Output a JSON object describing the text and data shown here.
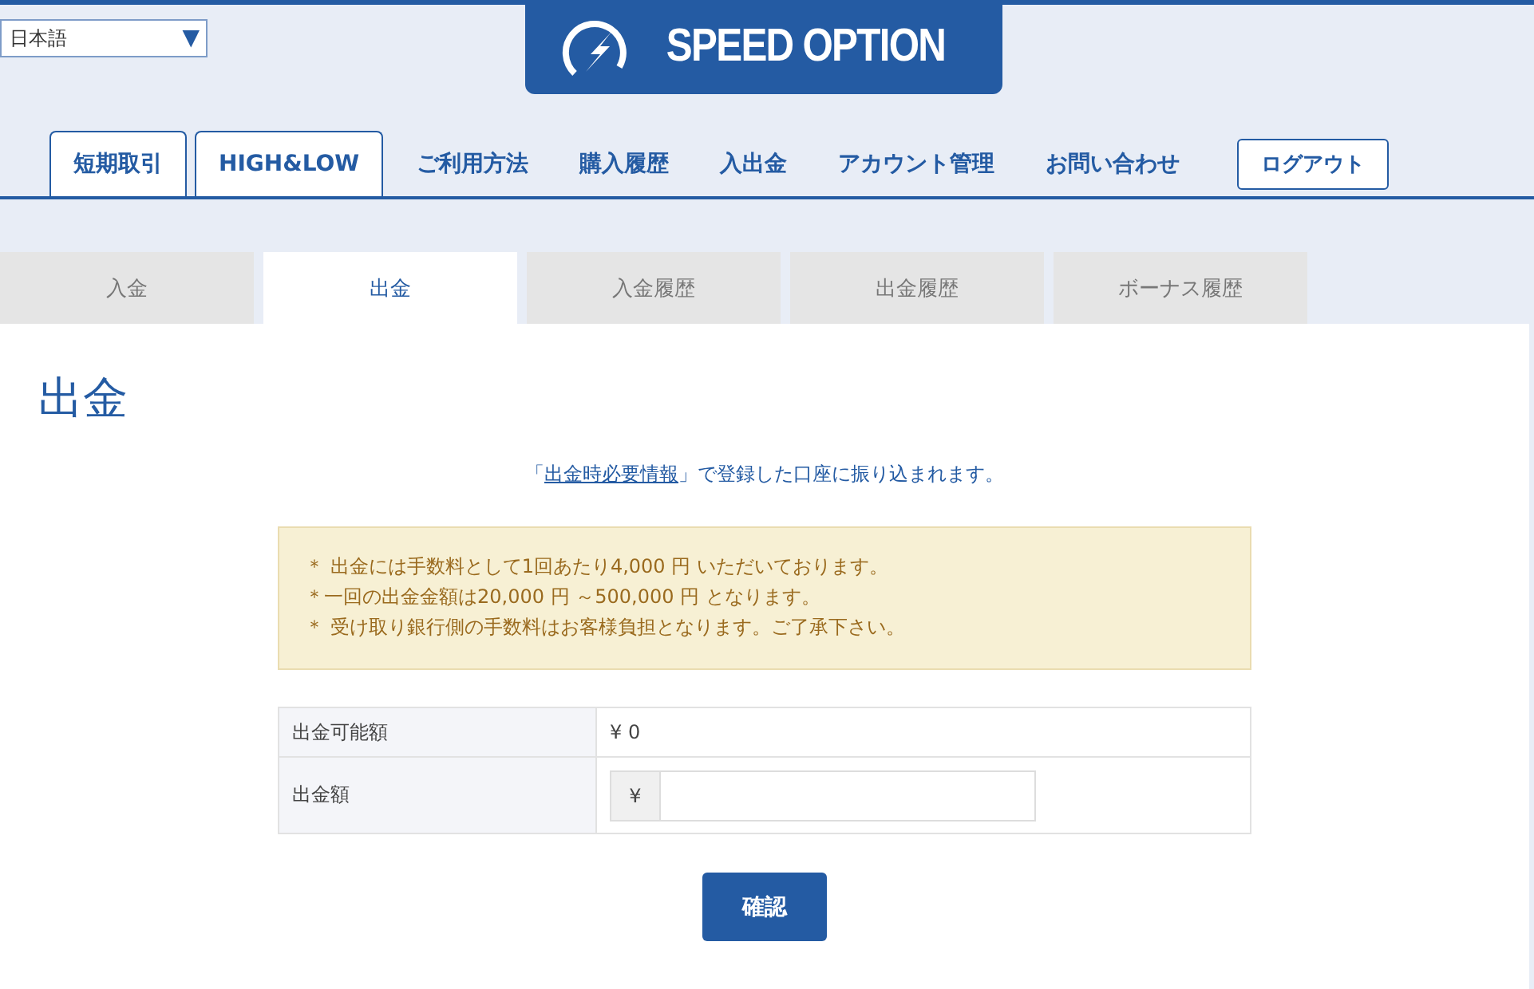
{
  "language_select": {
    "value": "日本語",
    "arrow": "▼"
  },
  "logo": {
    "text": "SPEED OPTION"
  },
  "nav": [
    {
      "label": "短期取引",
      "kind": "tab"
    },
    {
      "label": "HIGH&LOW",
      "kind": "tab"
    },
    {
      "label": "ご利用方法",
      "kind": "link"
    },
    {
      "label": "購入履歴",
      "kind": "link"
    },
    {
      "label": "入出金",
      "kind": "link"
    },
    {
      "label": "アカウント管理",
      "kind": "link"
    },
    {
      "label": "お問い合わせ",
      "kind": "link"
    },
    {
      "label": "ログアウト",
      "kind": "button"
    }
  ],
  "tabs": [
    {
      "label": "入金",
      "selected": false
    },
    {
      "label": "出金",
      "selected": true
    },
    {
      "label": "入金履歴",
      "selected": false
    },
    {
      "label": "出金履歴",
      "selected": false
    },
    {
      "label": "ボーナス履歴",
      "selected": false
    }
  ],
  "page_title": "出金",
  "intro": {
    "before": "「",
    "link": "出金時必要情報",
    "after": "」で登録した口座に振り込まれます。"
  },
  "notes": [
    "＊ 出金には手数料として1回あたり4,000 円 いただいております。",
    "＊一回の出金金額は20,000 円 ～500,000 円 となります。",
    "＊ 受け取り銀行側の手数料はお客様負担となります。ご了承下さい。"
  ],
  "form": {
    "rows": [
      {
        "label": "出金可能額",
        "kind": "value",
        "value": "¥ 0"
      },
      {
        "label": "出金額",
        "kind": "input",
        "prefix": "¥"
      }
    ]
  },
  "submit": "確認"
}
